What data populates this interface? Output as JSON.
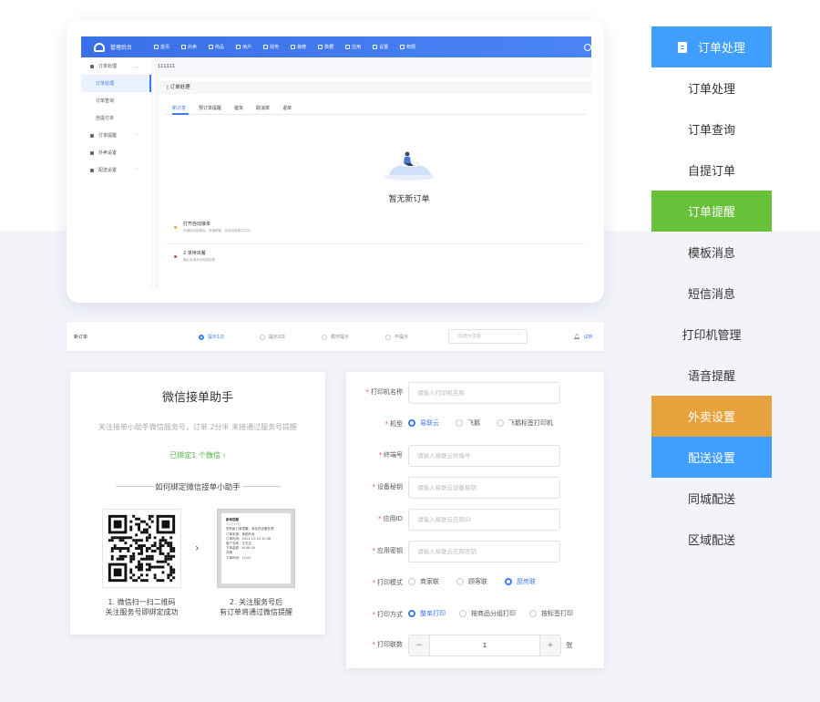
{
  "admin": {
    "title": "管理后台",
    "nav": [
      "首页",
      "外卖",
      "商品",
      "用户",
      "财务",
      "装修",
      "数据",
      "应用",
      "设置",
      "权限"
    ],
    "sidebar": {
      "group_order": "订单处理",
      "items_order": [
        "订单处理",
        "订单查询",
        "自提订单"
      ],
      "group_remind": "订单提醒",
      "group_takeout": "外卖设置",
      "group_delivery": "配送设置"
    },
    "breadcrumb": "111111",
    "panel_title": "| 订单处理",
    "tabs": [
      "新订单",
      "预订单提醒",
      "催单",
      "取消单",
      "退单"
    ],
    "empty_text": "暂无新订单",
    "notes": [
      {
        "title": "打开自动接单",
        "sub": "开通自动接单后，总速顾客，将自动接单并打印",
        "color": "#f0a030"
      },
      {
        "title": "2 单待出餐",
        "sub": "确认后请手动完成出餐",
        "color": "#e04040"
      }
    ]
  },
  "ring": {
    "label": "新订单",
    "options": [
      "提示1次",
      "提示3次",
      "循环提示",
      "不提示"
    ],
    "selected": 0,
    "select_placeholder": "经典女生版",
    "test_label": "试听"
  },
  "wechat": {
    "title": "微信接单助手",
    "desc": "关注接单小助手微信服务号，订单 2分半 未接通过服务号提醒",
    "bound": "已绑定1 个微信  ›",
    "how": "如何绑定微信接单小助手",
    "phone_lines": [
      "新单提醒",
      "12月12日",
      "您有新订单提醒，请及时查看处理",
      "订单来源：美团外卖",
      "订单时间：2021-12-10 12:08",
      "客户名称：王先生",
      "下单金额：¥108.00",
      "详情",
      "下单时间：12:02"
    ],
    "step1": [
      "1. 微信扫一扫二维码",
      "关注服务号即绑定成功"
    ],
    "step2": [
      "2. 关注服务号后",
      "有订单将通过微信提醒"
    ]
  },
  "printer_form": {
    "name_label": "打印机名称",
    "name_placeholder": "请输入打印机名称",
    "model_label": "机型",
    "models": [
      "易联云",
      "飞鹅",
      "飞鹅标签打印机"
    ],
    "model_selected": 0,
    "terminal_label": "终端号",
    "terminal_placeholder": "请输入易联云终端号",
    "secret_label": "设备秘钥",
    "secret_placeholder": "请输入易联云设备秘钥",
    "appid_label": "应用ID",
    "appid_placeholder": "请输入易联云应用ID",
    "appsecret_label": "应用密钥",
    "appsecret_placeholder": "请输入易联云应用密钥",
    "mode_label": "打印模式",
    "modes": [
      "商家联",
      "顾客联",
      "厨房联"
    ],
    "mode_selected": 2,
    "method_label": "打印方式",
    "methods": [
      "整单打印",
      "按商品分组打印",
      "按标签打印"
    ],
    "method_selected": 0,
    "copies_label": "打印联数",
    "copies_value": "1",
    "copies_unit": "张"
  },
  "right_menu": [
    {
      "label": "订单处理",
      "style": "blue",
      "icon": "clipboard-icon"
    },
    {
      "label": "订单处理",
      "style": "plain"
    },
    {
      "label": "订单查询",
      "style": "plain"
    },
    {
      "label": "自提订单",
      "style": "plain"
    },
    {
      "label": "订单提醒",
      "style": "green"
    },
    {
      "label": "模板消息",
      "style": "plain"
    },
    {
      "label": "短信消息",
      "style": "plain"
    },
    {
      "label": "打印机管理",
      "style": "plain"
    },
    {
      "label": "语音提醒",
      "style": "plain"
    },
    {
      "label": "外卖设置",
      "style": "orange"
    },
    {
      "label": "配送设置",
      "style": "blue"
    },
    {
      "label": "同城配送",
      "style": "plain"
    },
    {
      "label": "区域配送",
      "style": "plain"
    }
  ],
  "colors": {
    "accent": "#409eff",
    "green": "#67c23a",
    "orange": "#e6a23c",
    "topbar": "#3a6fe8"
  }
}
